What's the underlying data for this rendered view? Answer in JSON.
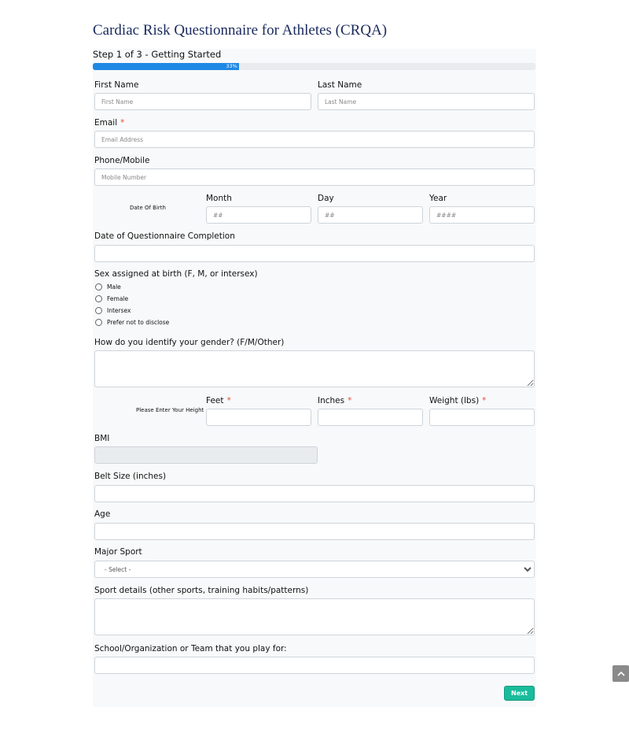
{
  "page": {
    "title": "Cardiac Risk Questionnaire for Athletes (CRQA)"
  },
  "step": {
    "label": "Step 1 of 3 - Getting Started",
    "progress_percent": 33,
    "progress_text": "33%"
  },
  "fields": {
    "first_name": {
      "label": "First Name",
      "placeholder": "First Name"
    },
    "last_name": {
      "label": "Last Name",
      "placeholder": "Last Name"
    },
    "email": {
      "label": "Email",
      "required_mark": "*",
      "placeholder": "Email Address"
    },
    "phone": {
      "label": "Phone/Mobile",
      "placeholder": "Mobile Number"
    },
    "dob": {
      "side_label": "Date Of Birth",
      "month": {
        "label": "Month",
        "placeholder": "##"
      },
      "day": {
        "label": "Day",
        "placeholder": "##"
      },
      "year": {
        "label": "Year",
        "placeholder": "####"
      }
    },
    "completion_date": {
      "label": "Date of Questionnaire Completion"
    },
    "sex": {
      "label": "Sex assigned at birth (F, M, or intersex)",
      "options": [
        "Male",
        "Female",
        "Intersex",
        "Prefer not to disclose"
      ]
    },
    "gender": {
      "label": "How do you identify your gender? (F/M/Other)"
    },
    "height": {
      "side_label": "Please Enter Your Height",
      "feet": {
        "label": "Feet",
        "required_mark": "*"
      },
      "inches": {
        "label": "Inches",
        "required_mark": "*"
      },
      "weight": {
        "label": "Weight (lbs)",
        "required_mark": "*"
      }
    },
    "bmi": {
      "label": "BMI"
    },
    "belt": {
      "label": "Belt Size (inches)"
    },
    "age": {
      "label": "Age"
    },
    "sport": {
      "label": "Major Sport",
      "selected": "- Select -"
    },
    "sport_details": {
      "label": "Sport details (other sports, training habits/patterns)"
    },
    "school": {
      "label": "School/Organization or Team that you play for:"
    }
  },
  "actions": {
    "next_label": "Next"
  },
  "icons": {
    "scroll_top": "chevron-up-icon"
  },
  "colors": {
    "accent": "#1e88e5",
    "next_button": "#1abc9c",
    "title": "#1a2a5e",
    "required": "#e74c3c"
  }
}
